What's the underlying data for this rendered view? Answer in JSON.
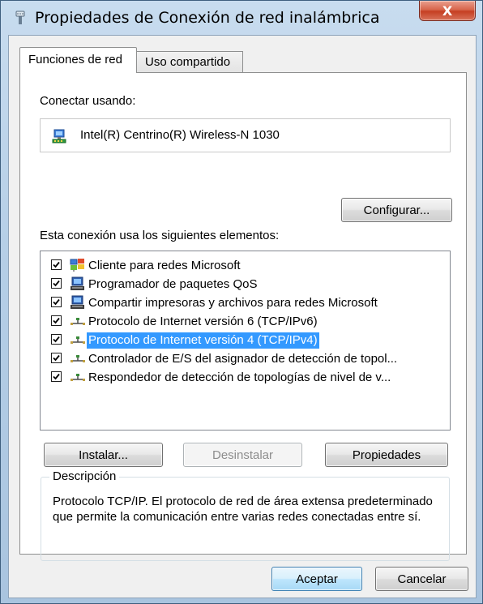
{
  "window": {
    "title": "Propiedades de Conexión de red inalámbrica",
    "close_label": "X"
  },
  "tabs": [
    {
      "label": "Funciones de red",
      "active": true
    },
    {
      "label": "Uso compartido",
      "active": false
    }
  ],
  "connect_using": {
    "label": "Conectar usando:",
    "adapter_name": "Intel(R) Centrino(R) Wireless-N 1030",
    "adapter_icon": "network-adapter-icon"
  },
  "configure_label": "Configurar...",
  "items_label": "Esta conexión usa los siguientes elementos:",
  "items": [
    {
      "label": "Cliente para redes Microsoft",
      "checked": true,
      "icon": "network-client-icon",
      "selected": false
    },
    {
      "label": "Programador de paquetes QoS",
      "checked": true,
      "icon": "network-service-icon",
      "selected": false
    },
    {
      "label": "Compartir impresoras y archivos para redes Microsoft",
      "checked": true,
      "icon": "network-service-icon",
      "selected": false
    },
    {
      "label": "Protocolo de Internet versión 6 (TCP/IPv6)",
      "checked": true,
      "icon": "protocol-icon",
      "selected": false
    },
    {
      "label": "Protocolo de Internet versión 4 (TCP/IPv4)",
      "checked": true,
      "icon": "protocol-icon",
      "selected": true
    },
    {
      "label": "Controlador de E/S del asignador de detección de topol...",
      "checked": true,
      "icon": "protocol-icon",
      "selected": false
    },
    {
      "label": "Respondedor de detección de topologías de nivel de v...",
      "checked": true,
      "icon": "protocol-icon",
      "selected": false
    }
  ],
  "actions": {
    "install": "Instalar...",
    "uninstall": "Desinstalar",
    "properties": "Propiedades"
  },
  "description": {
    "legend": "Descripción",
    "text": "Protocolo TCP/IP. El protocolo de red de área extensa predeterminado que permite la comunicación entre varias redes conectadas entre sí."
  },
  "footer": {
    "ok": "Aceptar",
    "cancel": "Cancelar"
  },
  "colors": {
    "selection": "#3399ff",
    "titlebar": "#b6cfe7",
    "close_button": "#c53f22"
  }
}
